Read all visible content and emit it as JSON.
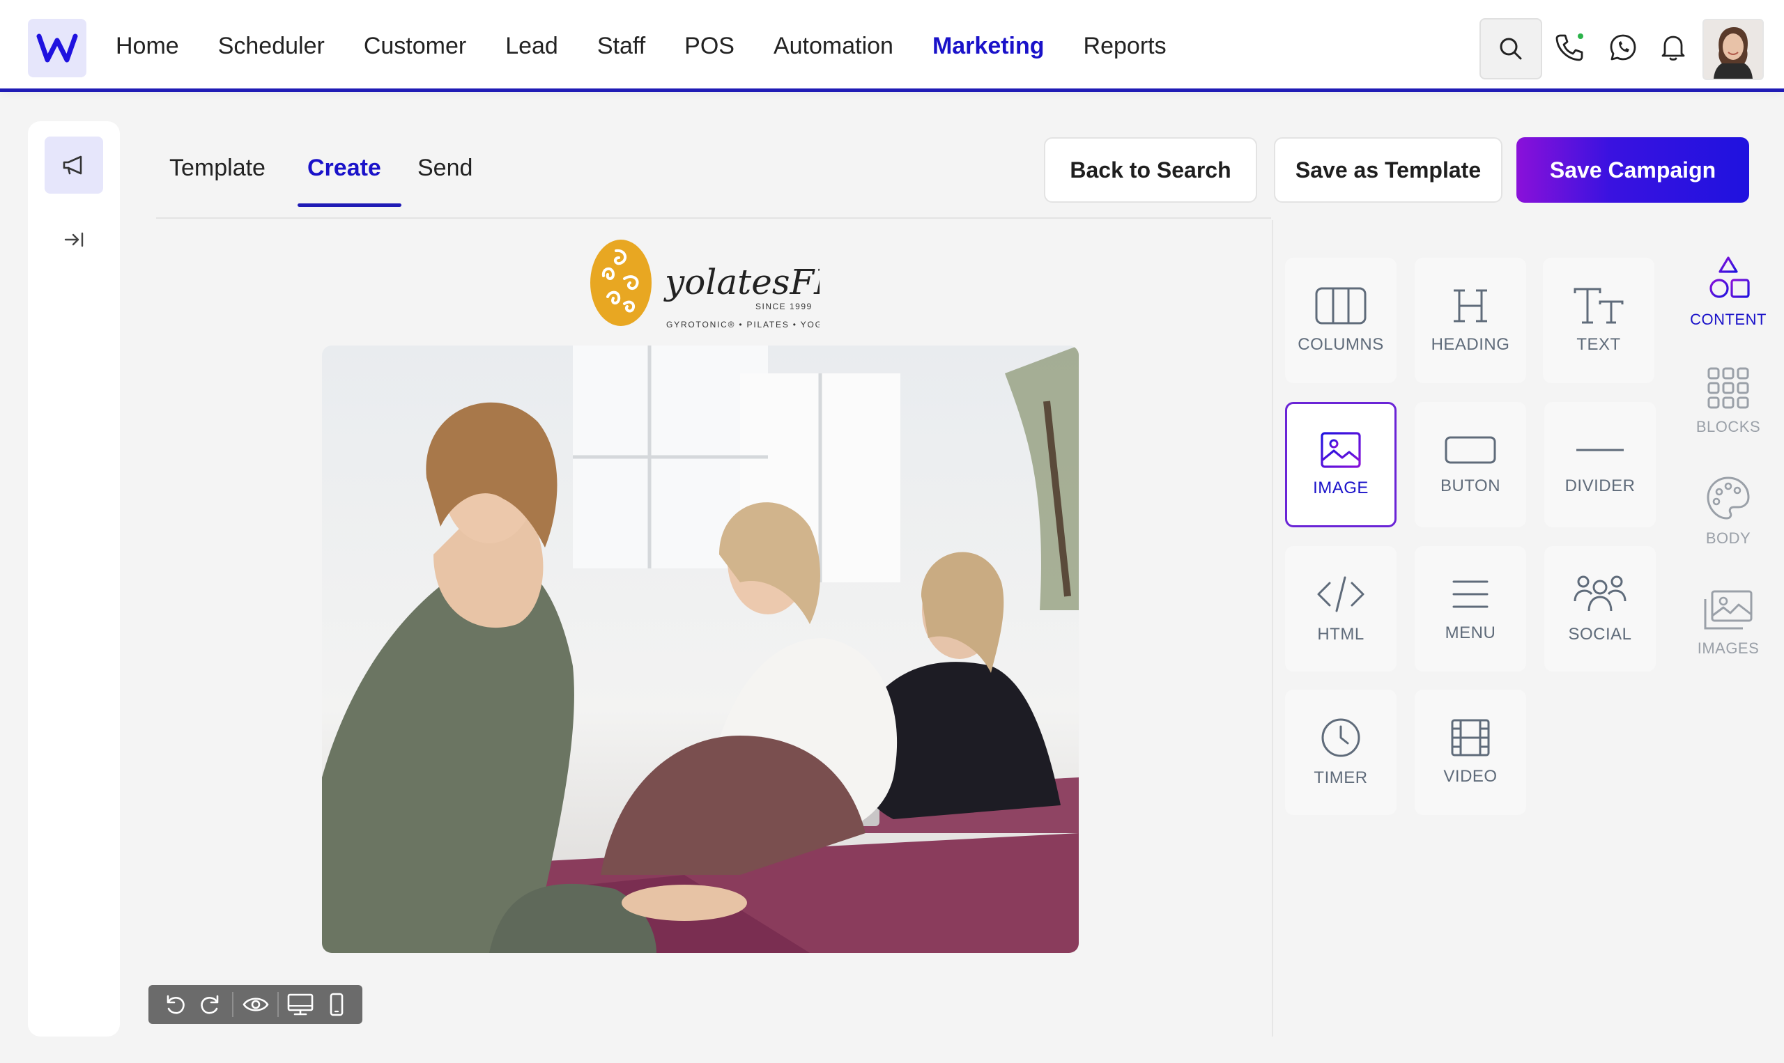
{
  "nav": {
    "items": [
      "Home",
      "Scheduler",
      "Customer",
      "Lead",
      "Staff",
      "POS",
      "Automation",
      "Marketing",
      "Reports"
    ],
    "active": "Marketing"
  },
  "header_icons": [
    "search-icon",
    "phone-icon",
    "whatsapp-icon",
    "bell-icon",
    "avatar"
  ],
  "tabs": {
    "items": [
      "Template",
      "Create",
      "Send"
    ],
    "active": "Create"
  },
  "actions": {
    "back": "Back to Search",
    "save_template": "Save as Template",
    "save_campaign": "Save Campaign"
  },
  "email": {
    "brand_name": "yolatesFIT",
    "brand_since": "SINCE 1999",
    "brand_tagline": "GYROTONIC® • PILATES • YOGA"
  },
  "content_tools": {
    "items": [
      "COLUMNS",
      "HEADING",
      "TEXT",
      "IMAGE",
      "BUTON",
      "DIVIDER",
      "HTML",
      "MENU",
      "SOCIAL",
      "TIMER",
      "VIDEO"
    ],
    "selected": "IMAGE"
  },
  "side_tabs": {
    "items": [
      "CONTENT",
      "BLOCKS",
      "BODY",
      "IMAGES"
    ],
    "active": "CONTENT"
  },
  "colors": {
    "accent": "#1a12c9",
    "gradient_start": "#8a11d9",
    "gradient_end": "#1f12df",
    "logo_yellow": "#e8a722"
  }
}
